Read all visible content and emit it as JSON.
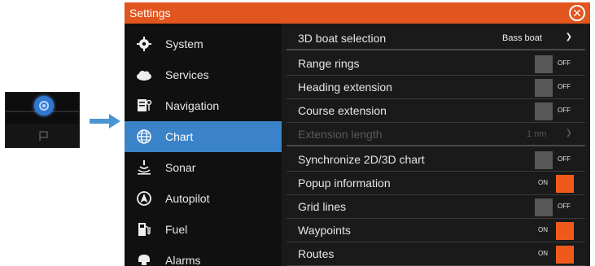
{
  "window": {
    "title": "Settings"
  },
  "sidebar": {
    "items": [
      {
        "label": "System",
        "icon": "gear-icon"
      },
      {
        "label": "Services",
        "icon": "cloud-icon"
      },
      {
        "label": "Navigation",
        "icon": "navigation-icon"
      },
      {
        "label": "Chart",
        "icon": "globe-icon",
        "selected": true
      },
      {
        "label": "Sonar",
        "icon": "sonar-icon"
      },
      {
        "label": "Autopilot",
        "icon": "autopilot-icon"
      },
      {
        "label": "Fuel",
        "icon": "fuel-pump-icon"
      },
      {
        "label": "Alarms",
        "icon": "alarm-icon"
      }
    ]
  },
  "settings": {
    "boat_selection": {
      "label": "3D boat selection",
      "value": "Bass boat"
    },
    "range_rings": {
      "label": "Range rings",
      "state": "OFF"
    },
    "heading_extension": {
      "label": "Heading extension",
      "state": "OFF"
    },
    "course_extension": {
      "label": "Course extension",
      "state": "OFF"
    },
    "extension_length": {
      "label": "Extension length",
      "value": "1 nm",
      "disabled": true
    },
    "synchronize": {
      "label": "Synchronize 2D/3D chart",
      "state": "OFF"
    },
    "popup_info": {
      "label": "Popup information",
      "state": "ON"
    },
    "grid_lines": {
      "label": "Grid lines",
      "state": "OFF"
    },
    "waypoints": {
      "label": "Waypoints",
      "state": "ON"
    },
    "routes": {
      "label": "Routes",
      "state": "ON"
    }
  },
  "colors": {
    "title_bar": "#e2551e",
    "selected": "#3a83c8",
    "toggle_on": "#ef5a1c",
    "toggle_off": "#575757"
  }
}
